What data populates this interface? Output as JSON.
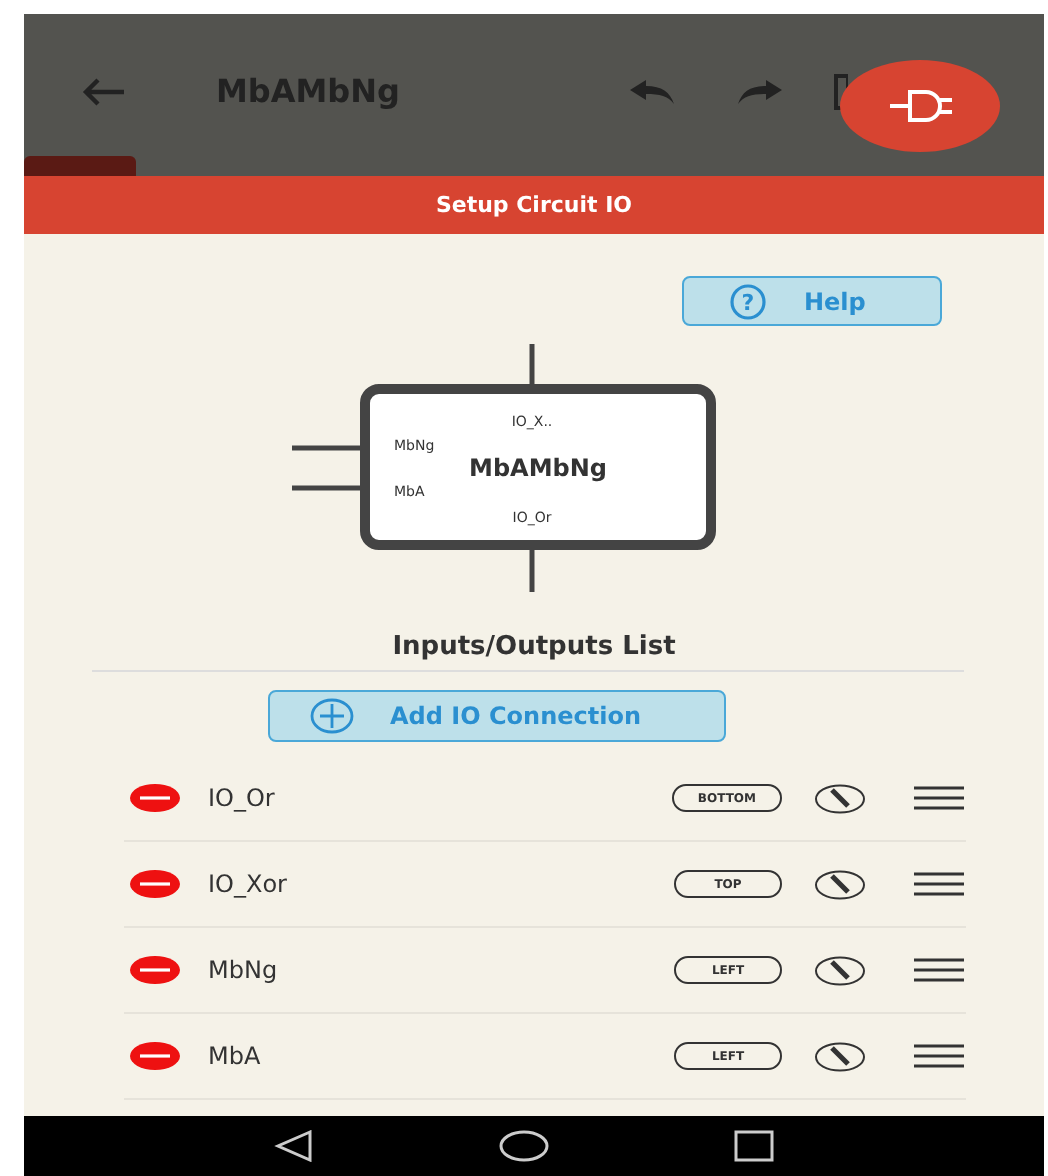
{
  "app_bar": {
    "title": "MbAMbNg"
  },
  "dialog": {
    "title": "Setup Circuit IO",
    "help_icon": "?",
    "help_button": "Help",
    "diagram": {
      "title": "MbAMbNg",
      "pins": [
        {
          "kind": "top",
          "label": "IO_X.."
        },
        {
          "kind": "left",
          "label": "MbNg"
        },
        {
          "kind": "left",
          "label": "MbA"
        },
        {
          "kind": "bottom",
          "label": "IO_Or"
        }
      ]
    },
    "list_title": "Inputs/Outputs List",
    "add_button": "Add IO Connection",
    "connections": [
      {
        "name": "IO_Or",
        "side": "BOTTOM"
      },
      {
        "name": "IO_Xor",
        "side": "TOP"
      },
      {
        "name": "MbNg",
        "side": "LEFT"
      },
      {
        "name": "MbA",
        "side": "LEFT"
      }
    ]
  }
}
